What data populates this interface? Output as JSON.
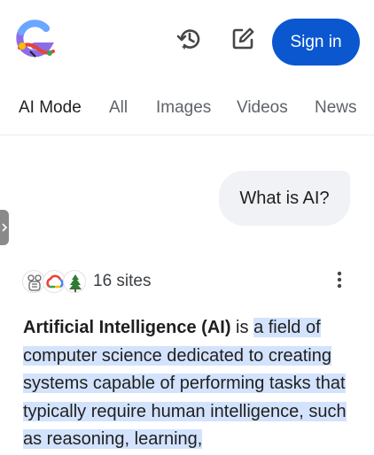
{
  "header": {
    "signin_label": "Sign in",
    "history_icon": "history-icon",
    "compose_icon": "edit-icon",
    "brand_colors": [
      "#4285f4",
      "#ea4335",
      "#fbbc04",
      "#34a853",
      "#a142f4"
    ]
  },
  "tabs": [
    {
      "label": "AI Mode",
      "active": true
    },
    {
      "label": "All",
      "active": false
    },
    {
      "label": "Images",
      "active": false
    },
    {
      "label": "Videos",
      "active": false
    },
    {
      "label": "News",
      "active": false
    }
  ],
  "query": {
    "text": "What is AI?"
  },
  "sources": {
    "count_label": "16 sites",
    "favicons": [
      "robot-icon",
      "google-cloud-icon",
      "stanford-tree-icon"
    ]
  },
  "answer": {
    "bold": "Artificial Intelligence (AI)",
    "plain": "is",
    "highlighted": "a field of computer science dedicated to creat­ing systems capable of performing tasks that typically require human in­telligence, such as reasoning, learn­ing,"
  },
  "colors": {
    "accent": "#0b57d0",
    "highlight": "#d3e3fd",
    "bubble": "#f0f2f5"
  }
}
